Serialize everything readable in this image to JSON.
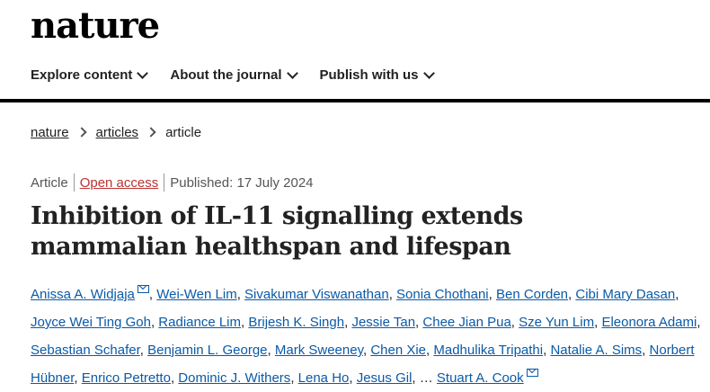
{
  "header": {
    "logo": "nature"
  },
  "nav": {
    "explore": "Explore content",
    "about": "About the journal",
    "publish": "Publish with us"
  },
  "breadcrumb": [
    "nature",
    "articles",
    "article"
  ],
  "meta": {
    "type": "Article",
    "access": "Open access",
    "published": "Published: 17 July 2024"
  },
  "title": "Inhibition of IL-11 signalling extends mammalian healthspan and lifespan",
  "authors": {
    "list": [
      "Anissa A. Widjaja",
      "Wei-Wen Lim",
      "Sivakumar Viswanathan",
      "Sonia Chothani",
      "Ben Corden",
      "Cibi Mary Dasan",
      "Joyce Wei Ting Goh",
      "Radiance Lim",
      "Brijesh K. Singh",
      "Jessie Tan",
      "Chee Jian Pua",
      "Sze Yun Lim",
      "Eleonora Adami",
      "Sebastian Schafer",
      "Benjamin L. George",
      "Mark Sweeney",
      "Chen Xie",
      "Madhulika Tripathi",
      "Natalie A. Sims",
      "Norbert Hübner",
      "Enrico Petretto",
      "Dominic J. Withers",
      "Lena Ho",
      "Jesus Gil",
      "Stuart A. Cook"
    ],
    "ellipsis": "…"
  },
  "colors": {
    "link": "#0a5aa8",
    "open_access": "#b33333"
  },
  "icons": {
    "contact": "envelope-icon"
  }
}
